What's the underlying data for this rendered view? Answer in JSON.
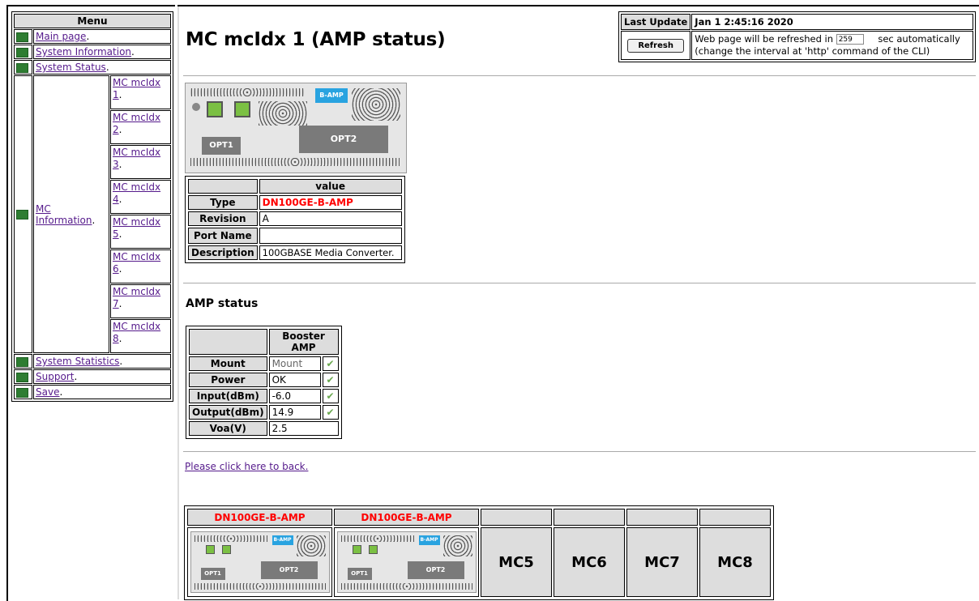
{
  "menu": {
    "header": "Menu",
    "items": [
      {
        "label": "Main page",
        "suffix": "."
      },
      {
        "label": "System Information",
        "suffix": "."
      },
      {
        "label": "System Status",
        "suffix": "."
      },
      {
        "label": "MC Information",
        "suffix": "."
      },
      {
        "label": "System Statistics",
        "suffix": "."
      },
      {
        "label": "Support",
        "suffix": "."
      },
      {
        "label": "Save",
        "suffix": "."
      }
    ],
    "mc_sub": [
      {
        "label": "MC mcIdx 1",
        "suffix": "."
      },
      {
        "label": "MC mcIdx 2",
        "suffix": "."
      },
      {
        "label": "MC mcIdx 3",
        "suffix": "."
      },
      {
        "label": "MC mcIdx 4",
        "suffix": "."
      },
      {
        "label": "MC mcIdx 5",
        "suffix": "."
      },
      {
        "label": "MC mcIdx 6",
        "suffix": "."
      },
      {
        "label": "MC mcIdx 7",
        "suffix": "."
      },
      {
        "label": "MC mcIdx 8",
        "suffix": "."
      }
    ]
  },
  "page": {
    "title": "MC mcIdx 1 (AMP status)",
    "section_title": "AMP status",
    "back_link": "Please click here to back."
  },
  "update": {
    "last_update_label": "Last Update",
    "last_update_value": "Jan 1 2:45:16 2020",
    "refresh_button": "Refresh",
    "refresh_text_before": "Web page will be refreshed in",
    "refresh_seconds": "259",
    "refresh_text_after": "sec automatically",
    "refresh_note": "(change the interval at 'http' command of the CLI)"
  },
  "device_image": {
    "badge": "B-AMP",
    "port1": "OPT1",
    "port2": "OPT2"
  },
  "info_table": {
    "header": "value",
    "rows": [
      {
        "label": "Type",
        "value": "DN100GE-B-AMP"
      },
      {
        "label": "Revision",
        "value": "A"
      },
      {
        "label": "Port Name",
        "value": ""
      },
      {
        "label": "Description",
        "value": "100GBASE Media Converter."
      }
    ]
  },
  "amp_table": {
    "header": "Booster AMP",
    "rows": [
      {
        "label": "Mount",
        "value": "Mount",
        "ok": true
      },
      {
        "label": "Power",
        "value": "OK",
        "ok": true
      },
      {
        "label": "Input(dBm)",
        "value": "-6.0",
        "ok": true
      },
      {
        "label": "Output(dBm)",
        "value": "14.9",
        "ok": true
      },
      {
        "label": "Voa(V)",
        "value": "2.5",
        "ok": false
      }
    ]
  },
  "mc_slots": {
    "slot1_type": "DN100GE-B-AMP",
    "slot2_type": "DN100GE-B-AMP",
    "mc5": "MC5",
    "mc6": "MC6",
    "mc7": "MC7",
    "mc8": "MC8"
  },
  "colors": {
    "type_red": "#ff0000",
    "badge_blue": "#29a3e0",
    "sfp_green": "#7bc043",
    "check_green": "#6aa84f"
  }
}
